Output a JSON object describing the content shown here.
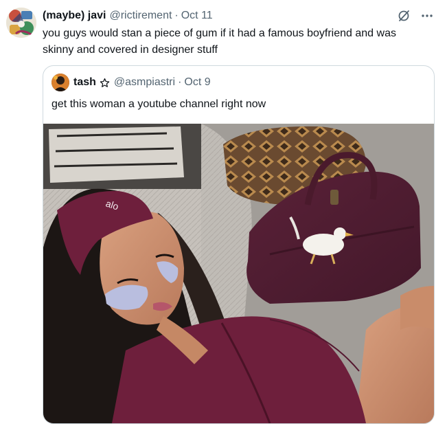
{
  "tweet": {
    "author_name": "(maybe) javi",
    "handle": "@rictirement",
    "separator": "·",
    "date": "Oct 11",
    "text": "you guys would stan a piece of gum if it had a famous boyfriend and was skinny and covered in designer stuff",
    "avatar_icon": "avatar-collage",
    "grok_icon": "grok-icon",
    "more_icon": "more-dots-icon"
  },
  "quote": {
    "author_name": "tash",
    "badge_icon": "star-icon",
    "handle": "@asmpiastri",
    "separator": "·",
    "date": "Oct 9",
    "text": "get this woman a youtube channel right now",
    "media": {
      "headband_logo": "alo",
      "description_icon": "selfie-photo"
    }
  },
  "colors": {
    "text_primary": "#0f1419",
    "text_secondary": "#536471",
    "border": "#cfd9de",
    "outfit_burgundy": "#6e1f3c",
    "bag_plum": "#5e2638"
  }
}
